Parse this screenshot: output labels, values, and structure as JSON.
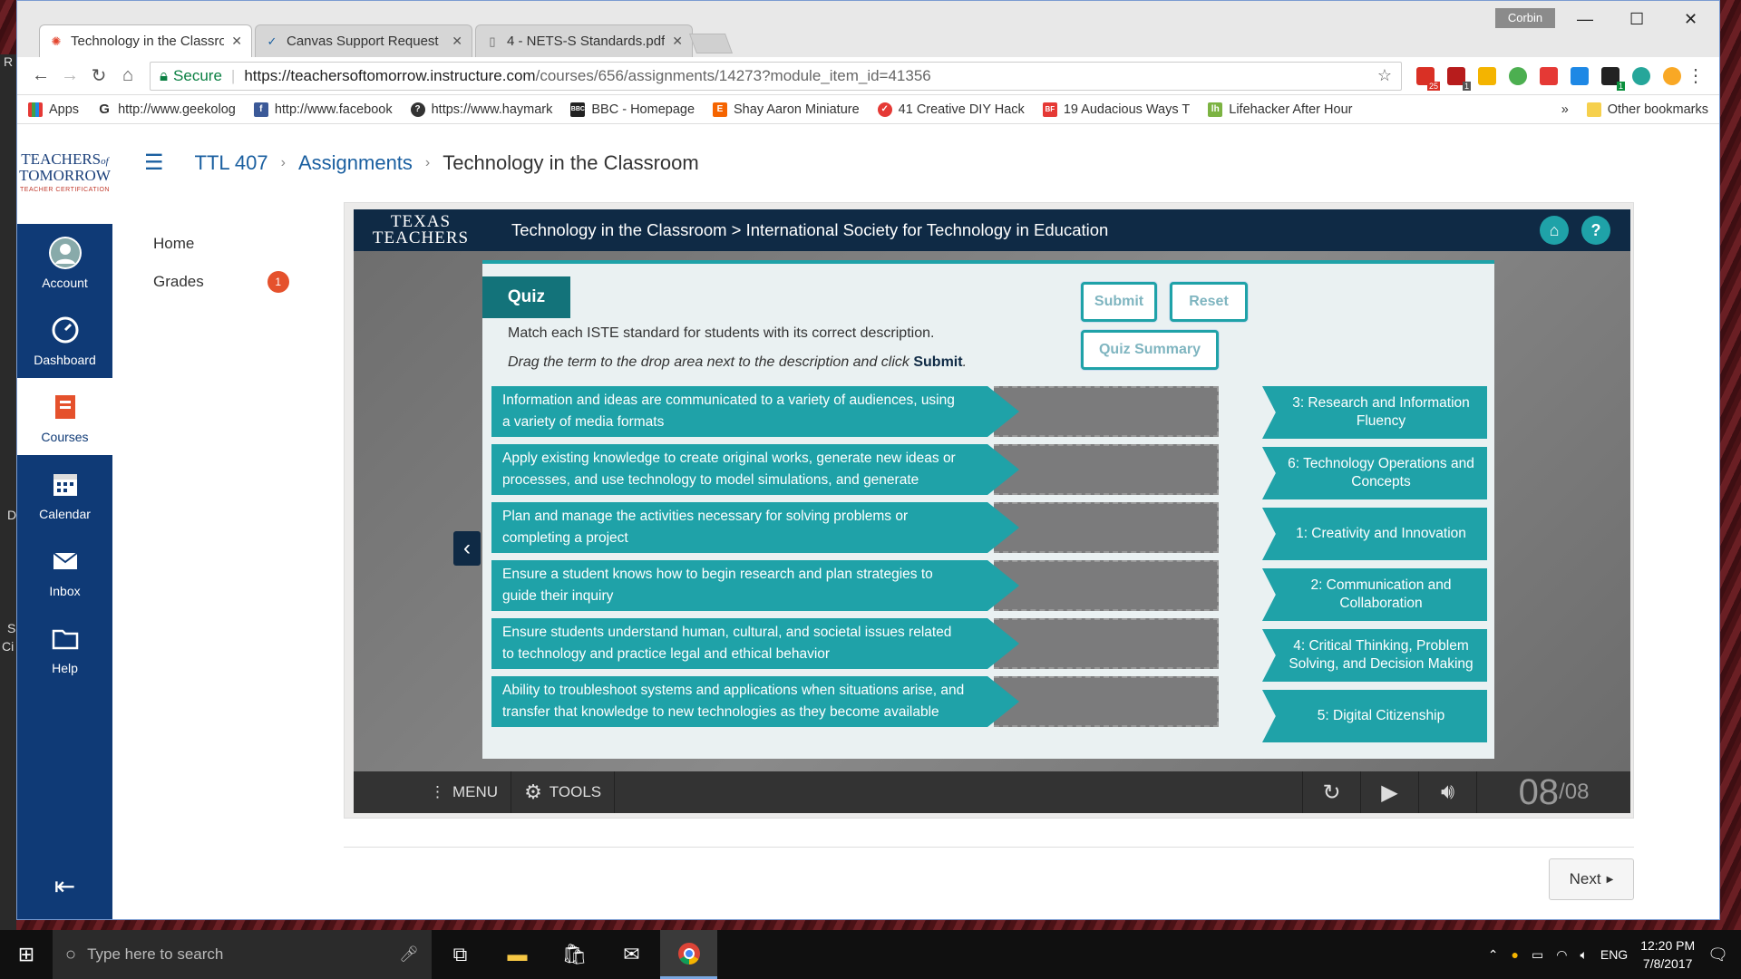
{
  "browser": {
    "tabs": [
      {
        "title": "Technology in the Classro",
        "icon": "canvas-icon"
      },
      {
        "title": "Canvas Support Request",
        "icon": "check-icon"
      },
      {
        "title": "4 - NETS-S Standards.pdf",
        "icon": "file-icon"
      }
    ],
    "profile": "Corbin",
    "secure_label": "Secure",
    "url_host": "https://teachersoftomorrow.instructure.com",
    "url_path": "/courses/656/assignments/14273?module_item_id=41356",
    "ext_badges": [
      "25",
      "1",
      "1"
    ]
  },
  "bookmarks": [
    "Apps",
    "http://www.geekolog",
    "http://www.facebook",
    "https://www.haymark",
    "BBC - Homepage",
    "Shay Aaron Miniature",
    "41 Creative DIY Hack",
    "19 Audacious Ways T",
    "Lifehacker After Hour"
  ],
  "bookmarks_more": "»",
  "bookmarks_other": "Other bookmarks",
  "canvas": {
    "logo_line1": "TEACHERS",
    "logo_of": "of",
    "logo_line2": "TOMORROW",
    "logo_sub": "TEACHER CERTIFICATION",
    "nav": [
      {
        "label": "Account",
        "icon": "user-icon"
      },
      {
        "label": "Dashboard",
        "icon": "dashboard-icon"
      },
      {
        "label": "Courses",
        "icon": "courses-icon"
      },
      {
        "label": "Calendar",
        "icon": "calendar-icon"
      },
      {
        "label": "Inbox",
        "icon": "inbox-icon"
      },
      {
        "label": "Help",
        "icon": "folder-icon"
      }
    ],
    "breadcrumb": {
      "course": "TTL 407",
      "section": "Assignments",
      "current": "Technology in the Classroom"
    },
    "course_nav": [
      {
        "label": "Home"
      },
      {
        "label": "Grades",
        "badge": "1"
      }
    ],
    "next_label": "Next"
  },
  "module": {
    "logo_top": "TEXAS",
    "logo_bottom": "TEACHERS",
    "title": "Technology in the Classroom > International Society for Technology in Education",
    "quiz_tag": "Quiz",
    "instruction": "Match each ISTE standard for students with its correct description.",
    "instruction2_pre": "Drag the term to the drop area next to the description and click ",
    "instruction2_bold": "Submit",
    "instruction2_post": ".",
    "buttons": {
      "submit": "Submit",
      "reset": "Reset",
      "summary": "Quiz Summary"
    },
    "descriptions": [
      "Information and ideas are communicated to a variety of audiences, using a variety of media formats",
      "Apply existing knowledge to create original works, generate new ideas or processes, and use technology to model simulations, and generate forecasts",
      "Plan and manage the activities necessary for solving problems or completing a project",
      "Ensure a student knows how to begin research and plan strategies to guide their inquiry",
      "Ensure students understand human, cultural, and societal issues related to technology and practice legal and ethical behavior",
      "Ability to troubleshoot systems and applications when situations arise, and transfer that knowledge to new technologies as they become available"
    ],
    "terms": [
      "3: Research and Information Fluency",
      "6: Technology Operations and Concepts",
      "1: Creativity and Innovation",
      "2: Communication and Collaboration",
      "4: Critical Thinking, Problem Solving, and Decision Making",
      "5: Digital Citizenship"
    ],
    "footer": {
      "menu": "MENU",
      "tools": "TOOLS",
      "page_current": "08",
      "page_total": "/08"
    }
  },
  "taskbar": {
    "search_placeholder": "Type here to search",
    "lang": "ENG",
    "time": "12:20 PM",
    "date": "7/8/2017"
  },
  "desktop_edge": [
    "R",
    "D",
    "S",
    "Ci"
  ]
}
